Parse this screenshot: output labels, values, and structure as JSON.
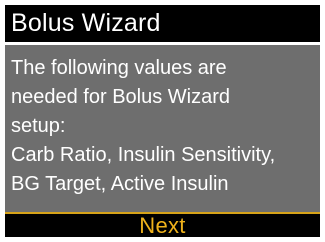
{
  "colors": {
    "title_bar": "#000000",
    "body_background": "#6e6e6e",
    "body_text": "#ffffff",
    "accent": "#efb21b"
  },
  "header": {
    "title": "Bolus Wizard"
  },
  "message": {
    "lines": [
      "The following values are",
      "needed for Bolus Wizard",
      "setup:",
      "Carb Ratio, Insulin Sensitivity,",
      "BG Target, Active Insulin"
    ]
  },
  "footer": {
    "next_label": "Next"
  }
}
